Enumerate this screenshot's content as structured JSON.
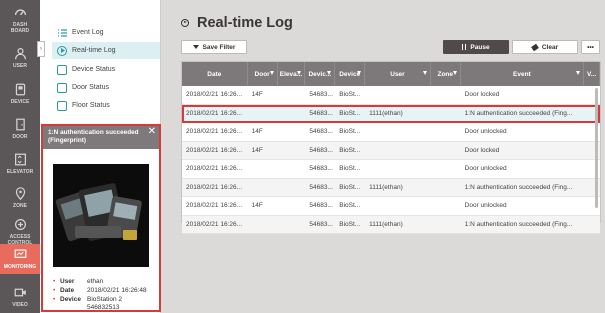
{
  "nav": {
    "items": [
      {
        "label": "DASH\nBOARD",
        "icon": "dashboard-icon"
      },
      {
        "label": "USER",
        "icon": "user-icon"
      },
      {
        "label": "DEVICE",
        "icon": "device-icon"
      },
      {
        "label": "DOOR",
        "icon": "door-icon"
      },
      {
        "label": "ELEVATOR",
        "icon": "elevator-icon"
      },
      {
        "label": "ZONE",
        "icon": "zone-icon"
      },
      {
        "label": "ACCESS\nCONTROL",
        "icon": "access-control-icon"
      },
      {
        "label": "MONITORING",
        "icon": "monitoring-icon"
      },
      {
        "label": "VIDEO",
        "icon": "video-icon"
      }
    ],
    "active_color": "#e96b5d"
  },
  "submenu": {
    "items": [
      {
        "label": "Event Log",
        "icon": "list-icon"
      },
      {
        "label": "Real-time Log",
        "icon": "play-icon"
      },
      {
        "label": "Device Status",
        "icon": "device-status-icon"
      },
      {
        "label": "Door Status",
        "icon": "door-status-icon"
      },
      {
        "label": "Floor Status",
        "icon": "floor-status-icon"
      }
    ],
    "collapse_glyph": "›"
  },
  "popup": {
    "title": "1:N authentication succeeded (Fingerprint)",
    "close": "✕",
    "user_key": "User",
    "user_val": "ethan",
    "date_key": "Date",
    "date_val": "2018/02/21 16:26:48",
    "device_key": "Device",
    "device_val": "BioStation 2 546832513",
    "border_color": "#d63a3a"
  },
  "main": {
    "title": "Real-time Log",
    "save_filter": "Save Filter",
    "pause": "Pause",
    "clear": "Clear",
    "more": "•••"
  },
  "table": {
    "columns": [
      "Date",
      "Door",
      "Eleva...",
      "Devic...",
      "Device",
      "User",
      "Zone",
      "Event",
      "V..."
    ],
    "rows": [
      [
        "2018/02/21 16:26...",
        "14F",
        "",
        "54683...",
        "BioSt...",
        "",
        "",
        "Door locked",
        ""
      ],
      [
        "2018/02/21 16:26...",
        "",
        "",
        "54683...",
        "BioSt...",
        "1111(ethan)",
        "",
        "1:N authentication succeeded (Fing...",
        ""
      ],
      [
        "2018/02/21 16:26...",
        "14F",
        "",
        "54683...",
        "BioSt...",
        "",
        "",
        "Door unlocked",
        ""
      ],
      [
        "2018/02/21 16:26...",
        "14F",
        "",
        "54683...",
        "BioSt...",
        "",
        "",
        "Door locked",
        ""
      ],
      [
        "2018/02/21 16:26...",
        "",
        "",
        "54683...",
        "BioSt...",
        "",
        "",
        "Door unlocked",
        ""
      ],
      [
        "2018/02/21 16:26...",
        "",
        "",
        "54683...",
        "BioSt...",
        "1111(ethan)",
        "",
        "1:N authentication succeeded (Fing...",
        ""
      ],
      [
        "2018/02/21 16:26...",
        "14F",
        "",
        "54683...",
        "BioSt...",
        "",
        "",
        "Door unlocked",
        ""
      ],
      [
        "2018/02/21 16:26...",
        "",
        "",
        "54683...",
        "BioSt...",
        "1111(ethan)",
        "",
        "1:N authentication succeeded (Fing...",
        ""
      ]
    ],
    "highlight_row": 1
  }
}
